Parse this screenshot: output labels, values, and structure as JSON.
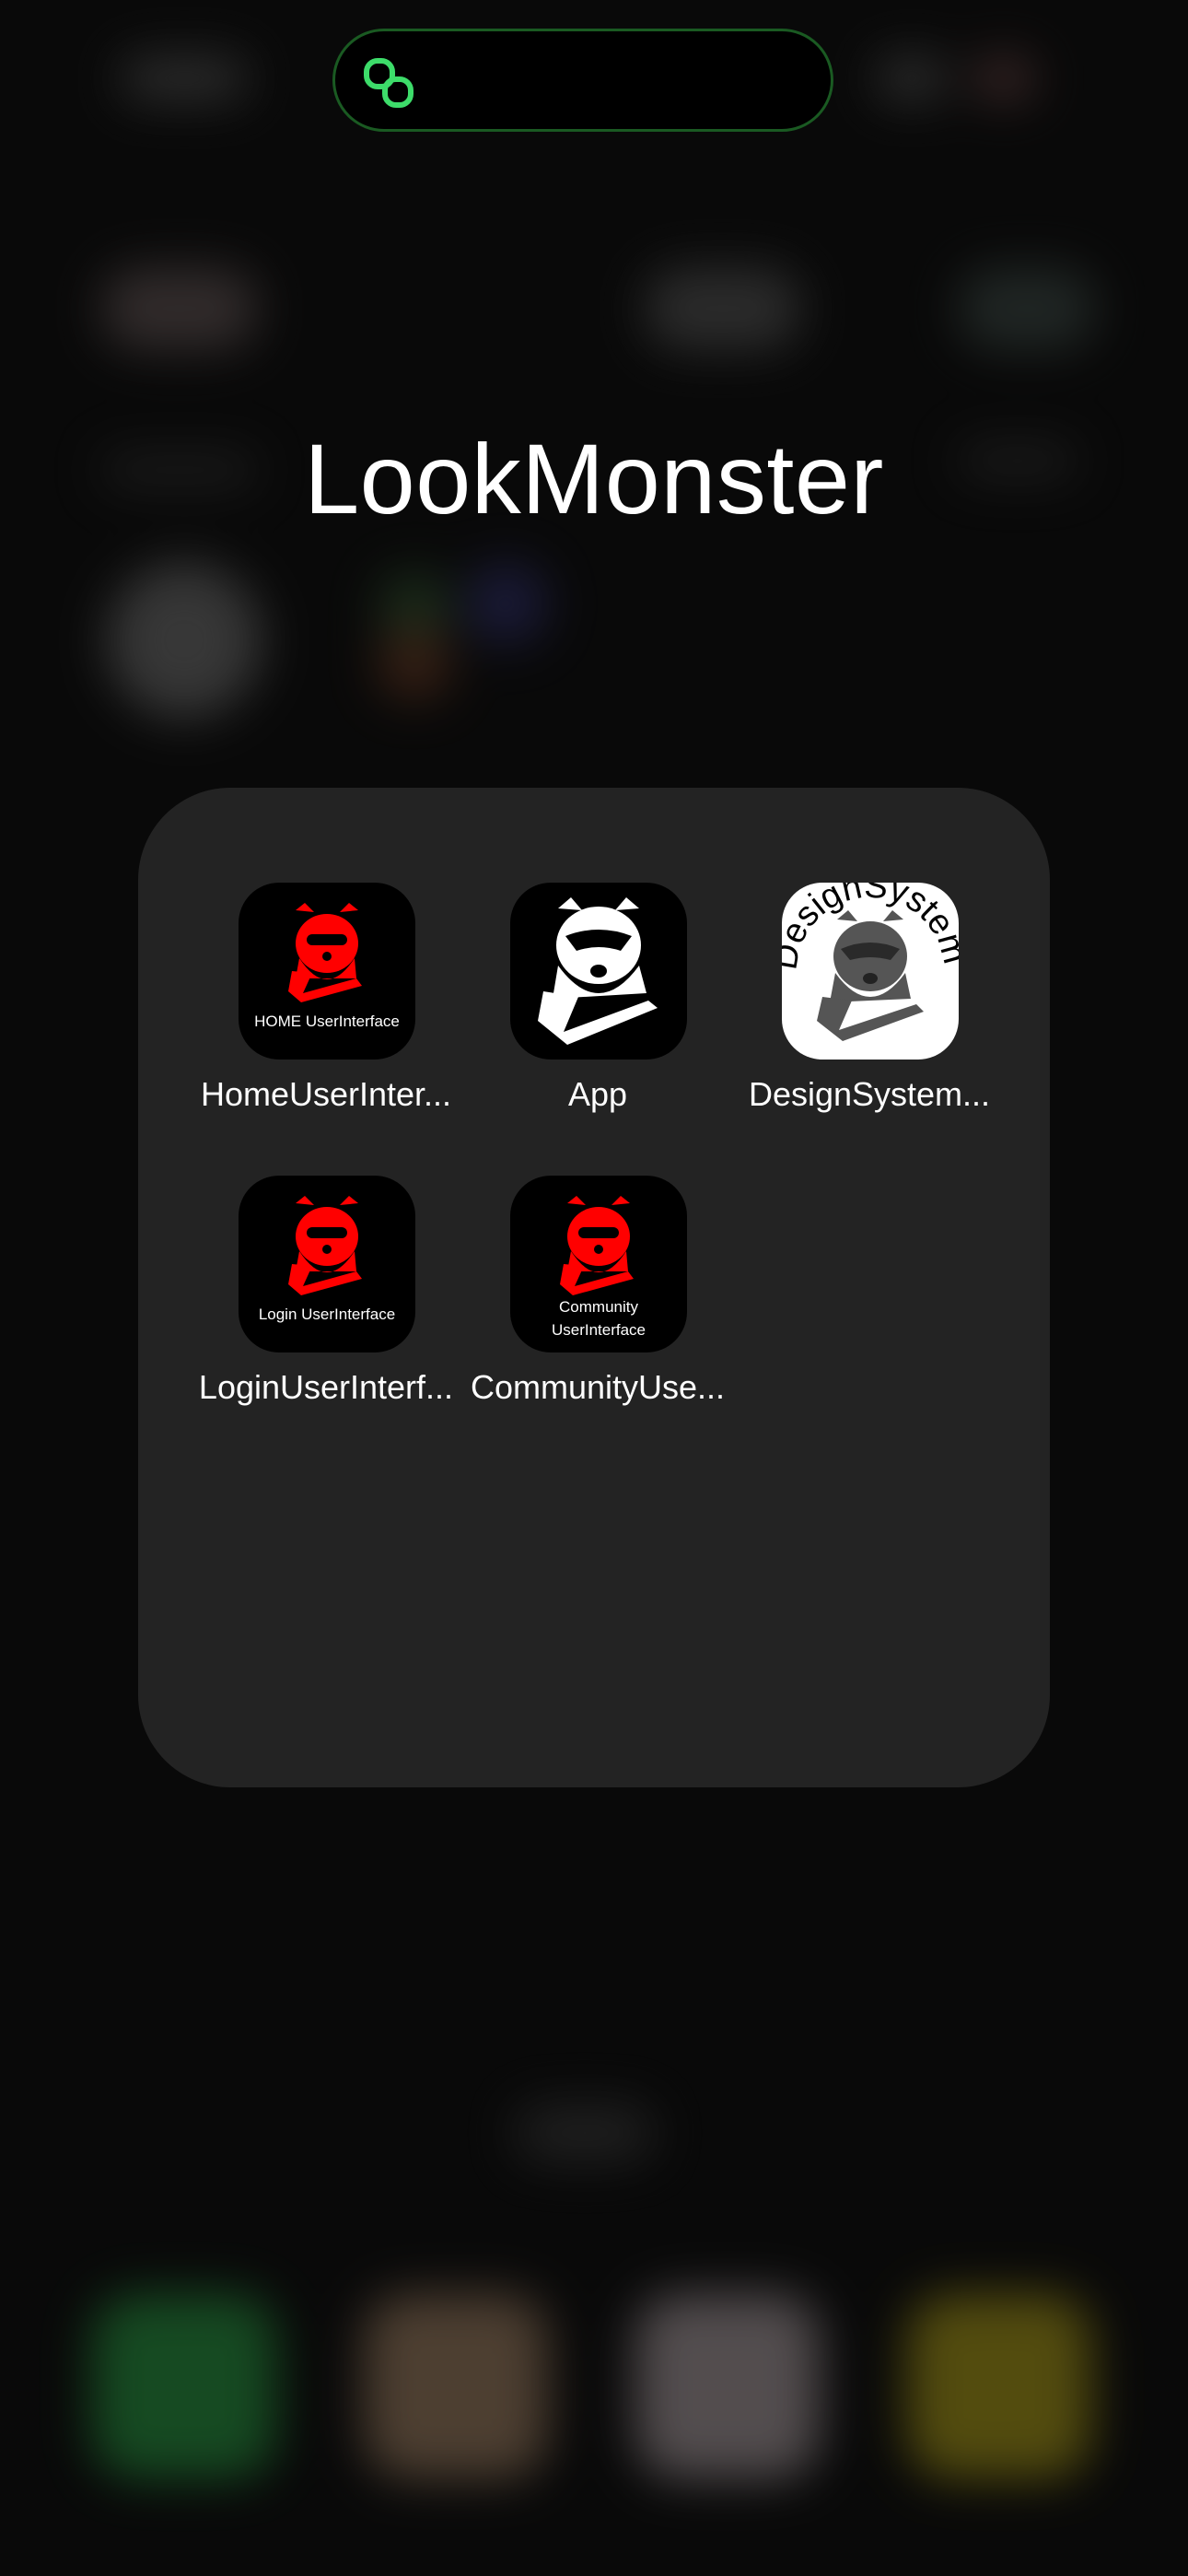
{
  "folder": {
    "title": "LookMonster"
  },
  "apps": [
    {
      "label": "HomeUserInter...",
      "icon_caption": "HOME UserInterface",
      "icon": "raccoon-red-icon",
      "icon_bg": "#000000",
      "icon_color": "#ff0000"
    },
    {
      "label": "App",
      "icon": "raccoon-white-icon",
      "icon_bg": "#000000",
      "icon_color": "#ffffff"
    },
    {
      "label": "DesignSystem...",
      "icon_ring_text": "DesignSystem",
      "icon": "raccoon-gray-icon",
      "icon_bg": "#ffffff",
      "icon_color": "#555555"
    },
    {
      "label": "LoginUserInterf...",
      "icon_caption": "Login UserInterface",
      "icon": "raccoon-red-icon",
      "icon_bg": "#000000",
      "icon_color": "#ff0000"
    },
    {
      "label": "CommunityUse...",
      "icon_caption_line1": "Community",
      "icon_caption_line2": "UserInterface",
      "icon": "raccoon-red-icon",
      "icon_bg": "#000000",
      "icon_color": "#ff0000"
    }
  ],
  "dynamic_island": {
    "icon": "link-icon",
    "accent": "#3ddc6a"
  },
  "colors": {
    "folder_bg": "#262626",
    "background": "#0a0a0a"
  }
}
